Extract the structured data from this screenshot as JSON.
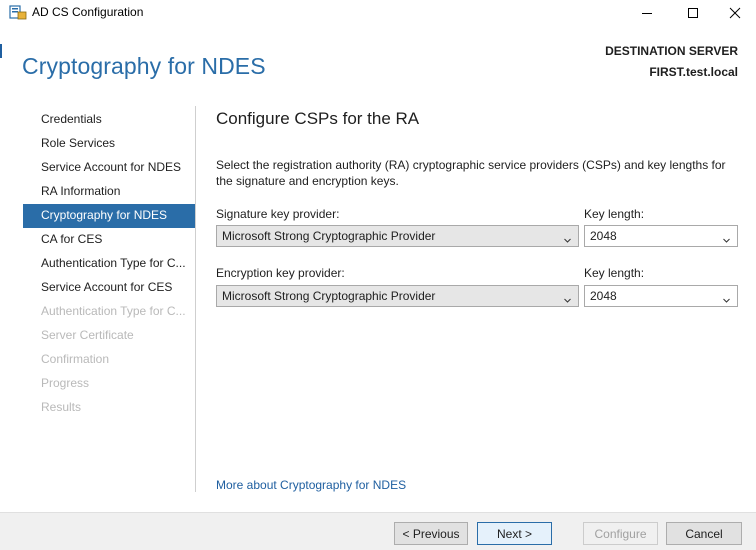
{
  "window": {
    "title": "AD CS Configuration",
    "controls": {
      "minimize": "minimize-icon",
      "maximize": "maximize-icon",
      "close": "close-icon"
    }
  },
  "header": {
    "title": "Cryptography for NDES",
    "destination_label": "DESTINATION SERVER",
    "destination_server": "FIRST.test.local"
  },
  "nav": {
    "items": [
      {
        "label": "Credentials",
        "state": "enabled"
      },
      {
        "label": "Role Services",
        "state": "enabled"
      },
      {
        "label": "Service Account for NDES",
        "state": "enabled"
      },
      {
        "label": "RA Information",
        "state": "enabled"
      },
      {
        "label": "Cryptography for NDES",
        "state": "active"
      },
      {
        "label": "CA for CES",
        "state": "enabled"
      },
      {
        "label": "Authentication Type for C...",
        "state": "enabled"
      },
      {
        "label": "Service Account for CES",
        "state": "enabled"
      },
      {
        "label": "Authentication Type for C...",
        "state": "disabled"
      },
      {
        "label": "Server Certificate",
        "state": "disabled"
      },
      {
        "label": "Confirmation",
        "state": "disabled"
      },
      {
        "label": "Progress",
        "state": "disabled"
      },
      {
        "label": "Results",
        "state": "disabled"
      }
    ]
  },
  "content": {
    "title": "Configure CSPs for the RA",
    "description": "Select the registration authority (RA) cryptographic service providers (CSPs) and key lengths for the signature and encryption keys.",
    "signature": {
      "provider_label": "Signature key provider:",
      "provider_value": "Microsoft Strong Cryptographic Provider",
      "key_length_label": "Key length:",
      "key_length_value": "2048"
    },
    "encryption": {
      "provider_label": "Encryption key provider:",
      "provider_value": "Microsoft Strong Cryptographic Provider",
      "key_length_label": "Key length:",
      "key_length_value": "2048"
    },
    "more_link": "More about Cryptography for NDES"
  },
  "footer": {
    "previous": "< Previous",
    "next": "Next >",
    "configure": "Configure",
    "cancel": "Cancel"
  },
  "colors": {
    "accent": "#2a6da8",
    "link": "#1f5fa0",
    "disabled_text": "#b9b9b9"
  }
}
